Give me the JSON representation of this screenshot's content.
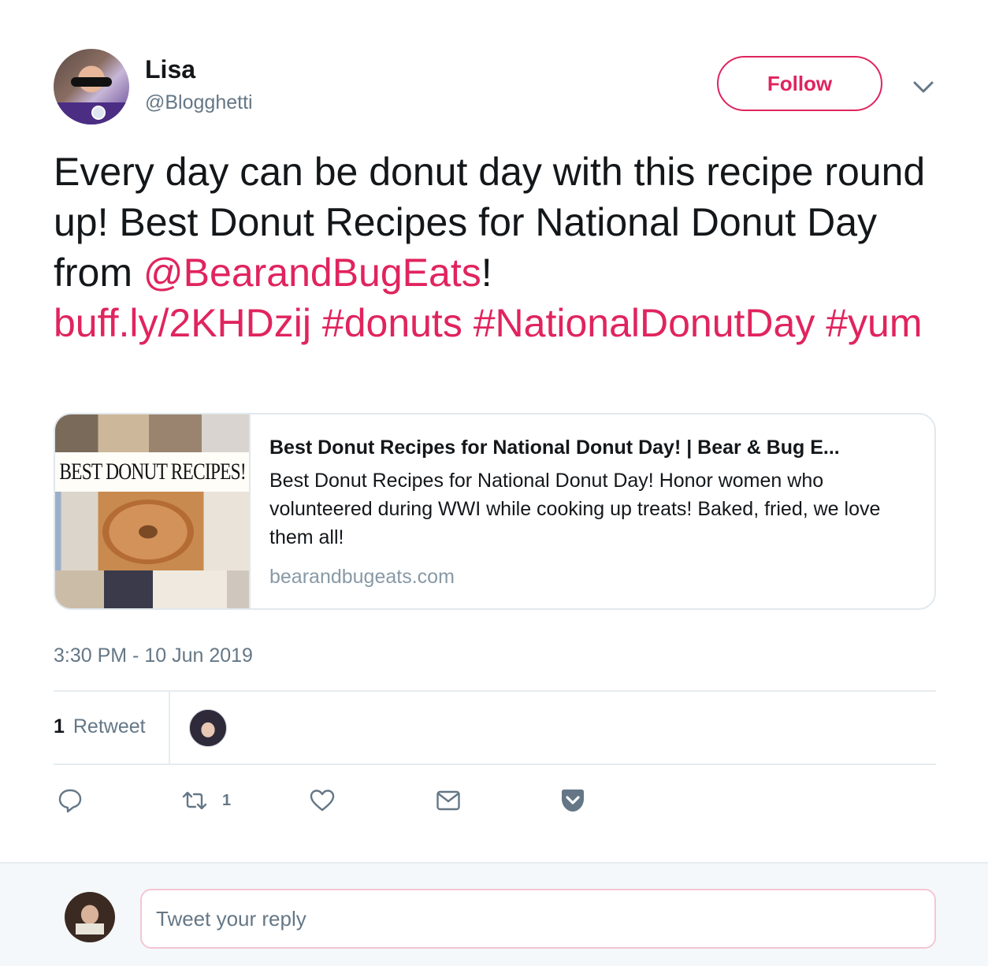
{
  "header": {
    "name": "Lisa",
    "handle": "@Blogghetti",
    "follow_label": "Follow"
  },
  "tweet": {
    "text_part1": "Every day can be donut day with this recipe round up!  Best Donut Recipes for National Donut Day from ",
    "mention": "@BearandBugEats",
    "text_part2": "!",
    "link": "buff.ly/2KHDzij",
    "hashtags": [
      "#donuts",
      "#NationalDonutDay",
      "#yum"
    ]
  },
  "card": {
    "thumb_title": "BEST DONUT RECIPES!",
    "title": "Best Donut Recipes for National Donut Day! | Bear & Bug E...",
    "description": "Best Donut Recipes for National Donut Day! Honor women who volunteered during WWI while cooking up treats! Baked, fried, we love them all!",
    "domain": "bearandbugeats.com"
  },
  "timestamp": "3:30 PM - 10 Jun 2019",
  "stats": {
    "retweet_count": "1",
    "retweet_label": "Retweet"
  },
  "actions": {
    "retweet_count": "1"
  },
  "reply": {
    "placeholder": "Tweet your reply"
  },
  "colors": {
    "accent": "#e0245e",
    "secondary_text": "#657786",
    "border": "#e1e8ed"
  }
}
